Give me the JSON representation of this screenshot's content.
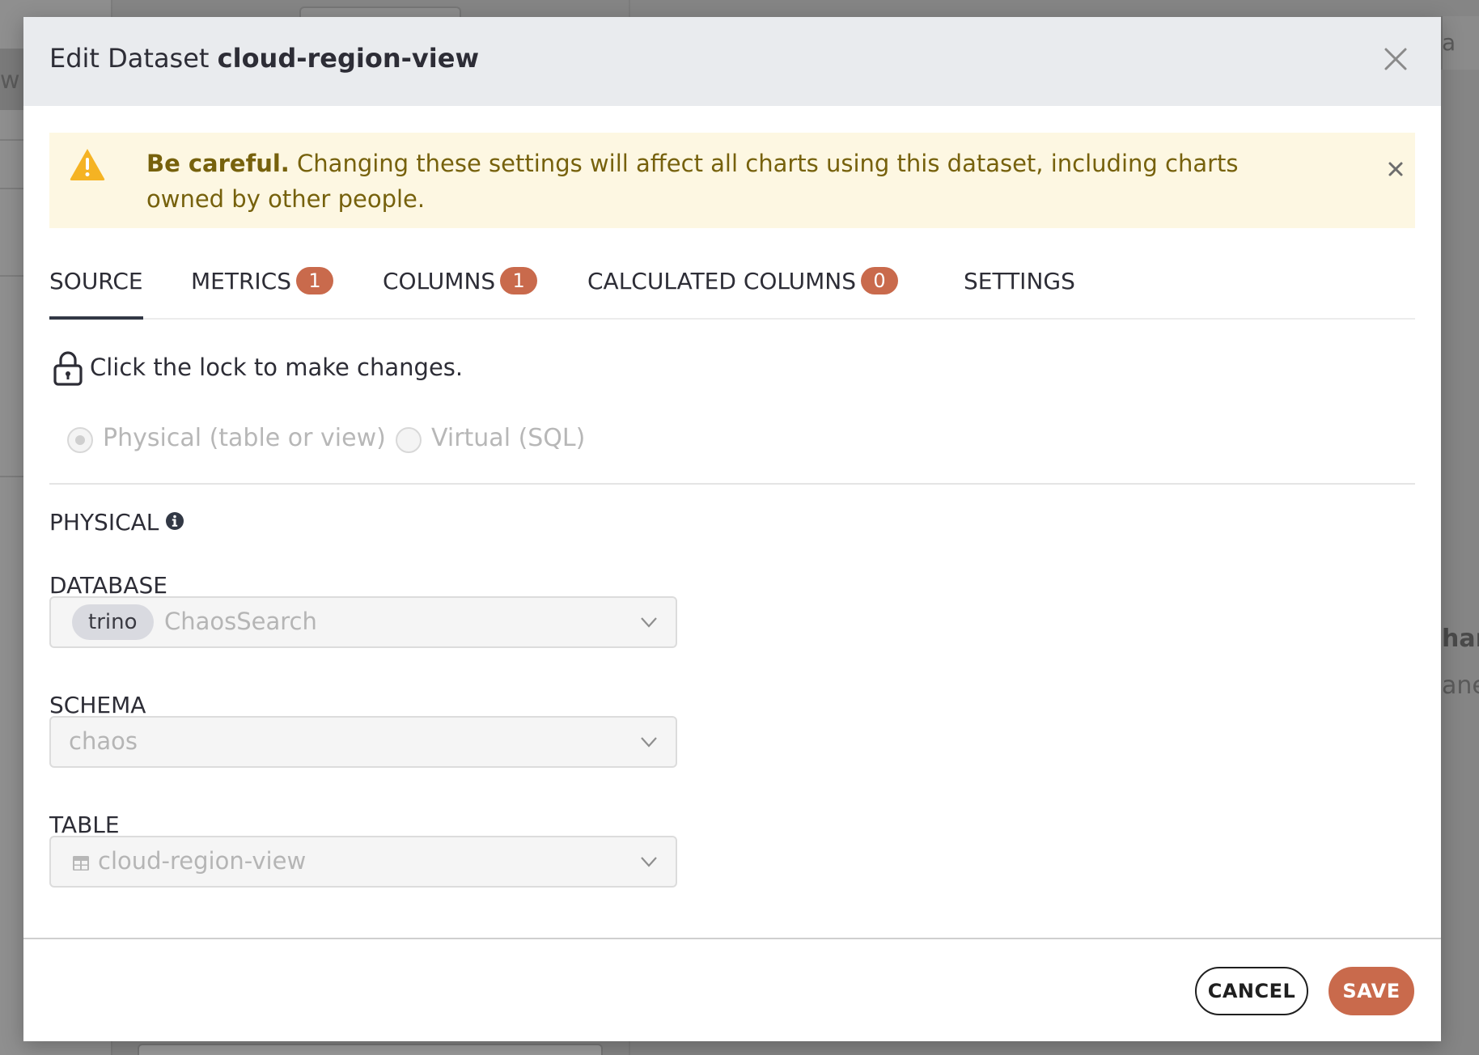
{
  "background": {
    "fragment_left": "w",
    "fragment_right_top": "a",
    "fragment_right_1": "har",
    "fragment_right_2": "ane"
  },
  "modal": {
    "title_prefix": "Edit Dataset ",
    "title_name": "cloud-region-view"
  },
  "alert": {
    "bold": "Be careful.",
    "message": " Changing these settings will affect all charts using this dataset, including charts owned by other people."
  },
  "tabs": [
    {
      "label": "SOURCE",
      "badge": null,
      "active": true
    },
    {
      "label": "METRICS",
      "badge": "1"
    },
    {
      "label": "COLUMNS",
      "badge": "1"
    },
    {
      "label": "CALCULATED COLUMNS",
      "badge": "0"
    },
    {
      "label": "SETTINGS",
      "badge": null
    }
  ],
  "lock": {
    "text": "Click the lock to make changes."
  },
  "radios": {
    "physical": "Physical (table or view)",
    "virtual": "Virtual (SQL)",
    "selected": "physical"
  },
  "physical_section": {
    "label": "PHYSICAL"
  },
  "database": {
    "label": "DATABASE",
    "tag": "trino",
    "value": "ChaosSearch"
  },
  "schema": {
    "label": "SCHEMA",
    "value": "chaos"
  },
  "table": {
    "label": "TABLE",
    "value": "cloud-region-view"
  },
  "footer": {
    "cancel": "CANCEL",
    "save": "SAVE"
  },
  "colors": {
    "accent": "#c96a4c",
    "warning_bg": "#fdf7e2",
    "warning_text": "#76610c",
    "warning_icon": "#f5b323",
    "header_bg": "#e9ebee"
  }
}
